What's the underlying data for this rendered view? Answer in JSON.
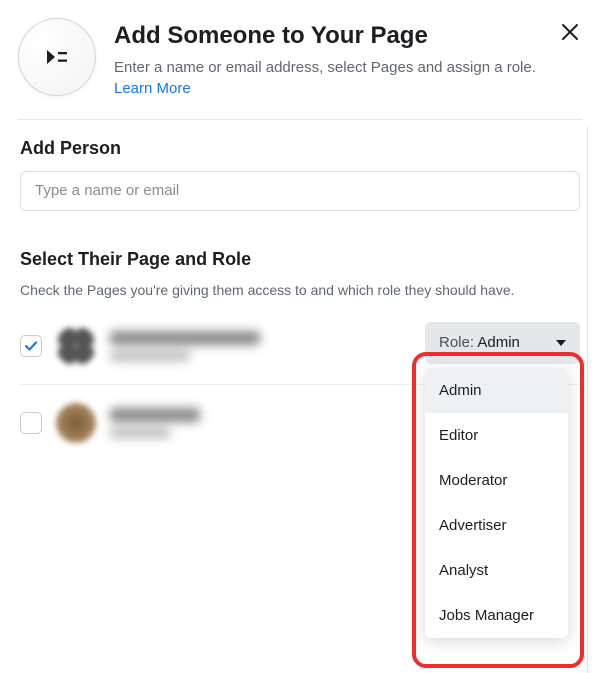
{
  "header": {
    "title": "Add Someone to Your Page",
    "subtitle_pre": "Enter a name or email address, select Pages and assign a role. ",
    "learn_more": "Learn More"
  },
  "add_person": {
    "title": "Add Person",
    "placeholder": "Type a name or email"
  },
  "select_section": {
    "title": "Select Their Page and Role",
    "description": "Check the Pages you're giving them access to and which role they should have."
  },
  "role_picker": {
    "label_prefix": "Role: ",
    "selected": "Admin",
    "options": [
      "Admin",
      "Editor",
      "Moderator",
      "Advertiser",
      "Analyst",
      "Jobs Manager"
    ]
  },
  "pages": [
    {
      "checked": true
    },
    {
      "checked": false
    }
  ]
}
